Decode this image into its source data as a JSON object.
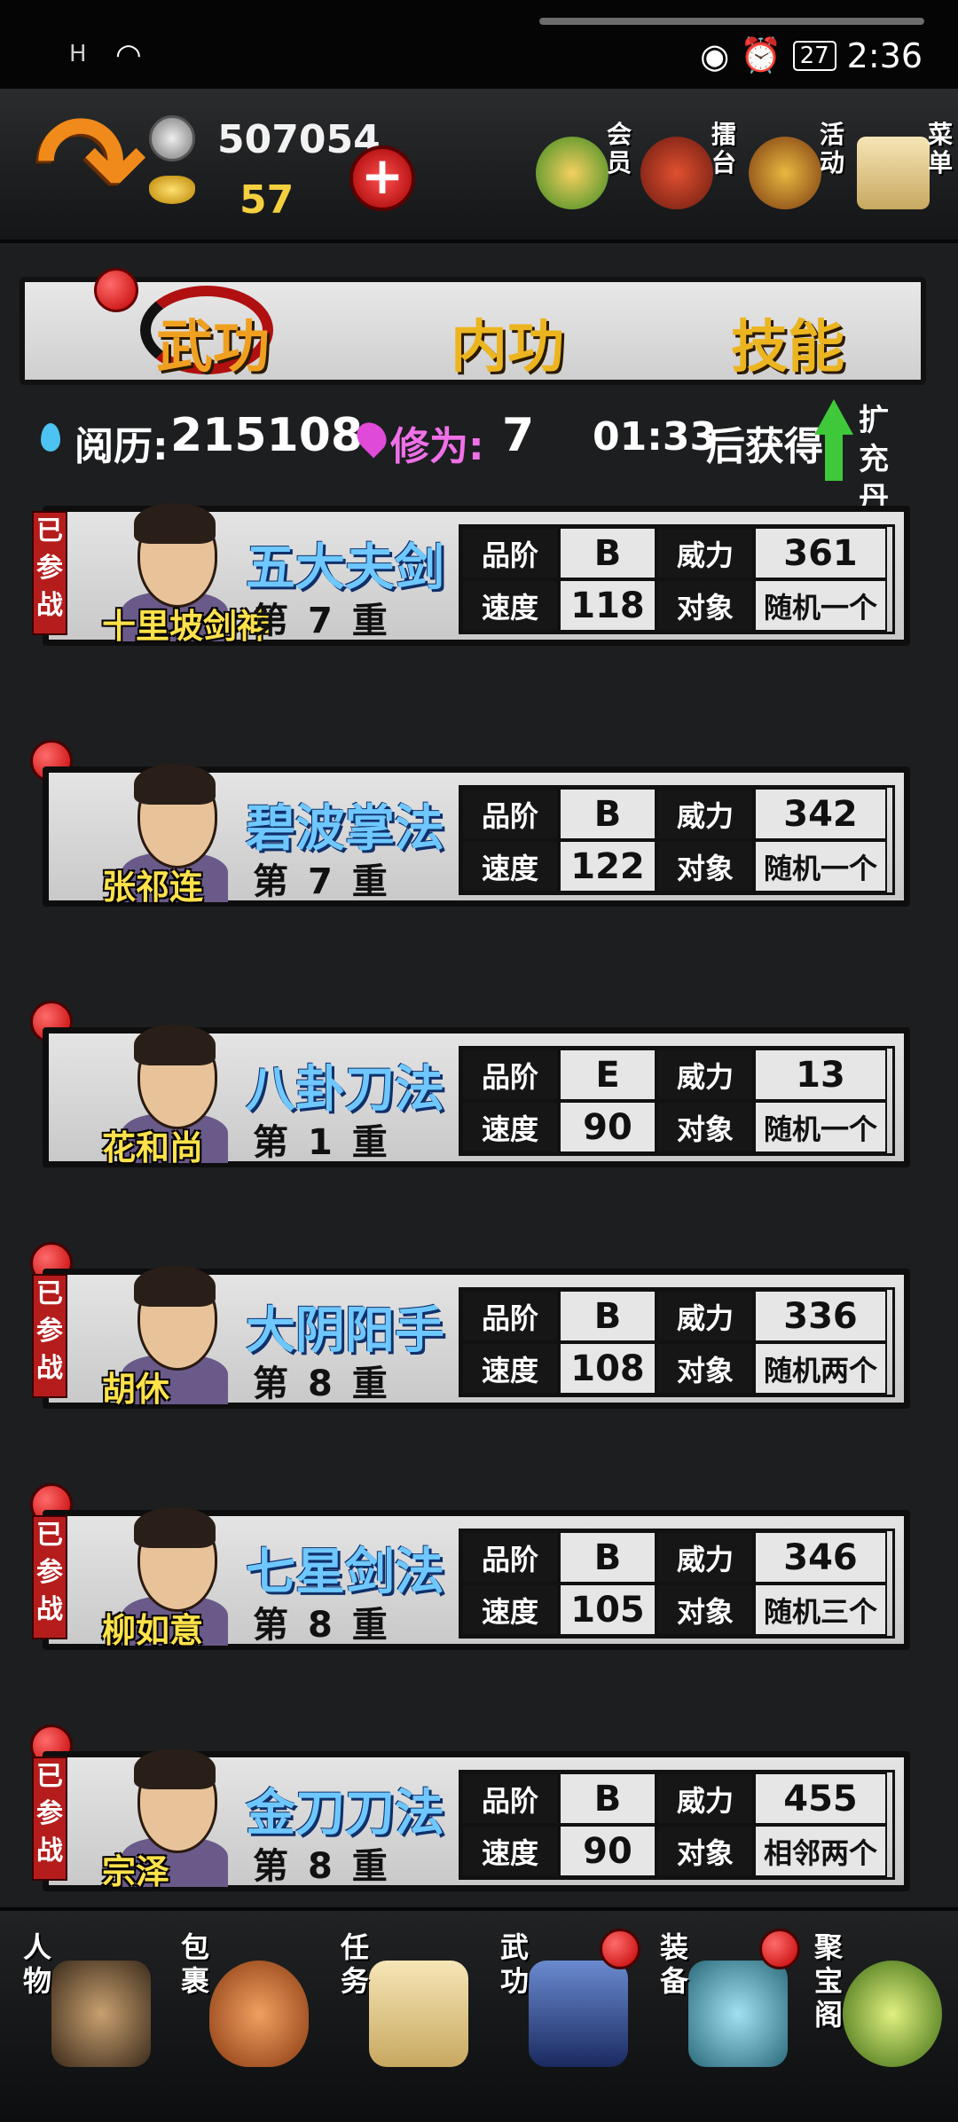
{
  "status_bar": {
    "signal": "H",
    "battery": "27",
    "time": "2:36"
  },
  "currency": {
    "silver": "507054",
    "gold": "57"
  },
  "top_menu": [
    {
      "id": "member",
      "label": "会员"
    },
    {
      "id": "arena",
      "label": "擂台"
    },
    {
      "id": "activity",
      "label": "活动"
    },
    {
      "id": "menu",
      "label": "菜单"
    }
  ],
  "tabs": [
    {
      "id": "martial",
      "label": "武功",
      "active": true
    },
    {
      "id": "inner",
      "label": "内功",
      "active": false
    },
    {
      "id": "skill",
      "label": "技能",
      "active": false
    }
  ],
  "stats": {
    "experience_label": "阅历:",
    "experience_value": "215108",
    "cultivation_label": "修为:",
    "cultivation_value": "7",
    "timer": "01:33",
    "timer_suffix": "后获得",
    "expand_label": "扩充丹田"
  },
  "labels": {
    "grade": "品阶",
    "power": "威力",
    "speed": "速度",
    "target": "对象",
    "level_prefix": "第",
    "level_suffix": "重",
    "in_battle": "已参战"
  },
  "cards": [
    {
      "character": "十里坡剑神",
      "skill": "五大夫剑",
      "level": "7",
      "grade": "B",
      "power": "361",
      "speed": "118",
      "target": "随机一个",
      "in_battle": true,
      "dot": false
    },
    {
      "character": "张祁连",
      "skill": "碧波掌法",
      "level": "7",
      "grade": "B",
      "power": "342",
      "speed": "122",
      "target": "随机一个",
      "in_battle": false,
      "dot": true
    },
    {
      "character": "花和尚",
      "skill": "八卦刀法",
      "level": "1",
      "grade": "E",
      "power": "13",
      "speed": "90",
      "target": "随机一个",
      "in_battle": false,
      "dot": true
    },
    {
      "character": "胡休",
      "skill": "大阴阳手",
      "level": "8",
      "grade": "B",
      "power": "336",
      "speed": "108",
      "target": "随机两个",
      "in_battle": true,
      "dot": true
    },
    {
      "character": "柳如意",
      "skill": "七星剑法",
      "level": "8",
      "grade": "B",
      "power": "346",
      "speed": "105",
      "target": "随机三个",
      "in_battle": true,
      "dot": true
    },
    {
      "character": "宗泽",
      "skill": "金刀刀法",
      "level": "8",
      "grade": "B",
      "power": "455",
      "speed": "90",
      "target": "相邻两个",
      "in_battle": true,
      "dot": true
    }
  ],
  "bottom_nav": [
    {
      "id": "character",
      "label": "人物",
      "dot": false
    },
    {
      "id": "bag",
      "label": "包裹",
      "dot": false
    },
    {
      "id": "quest",
      "label": "任务",
      "dot": false
    },
    {
      "id": "martial",
      "label": "武功",
      "dot": true
    },
    {
      "id": "equip",
      "label": "装备",
      "dot": true
    },
    {
      "id": "treasure",
      "label": "聚宝阁",
      "dot": false
    }
  ],
  "colors": {
    "accent_red": "#c00000",
    "skill_blue": "#6ec8ff",
    "name_yellow": "#ffe24a",
    "tab_gold": "#ecb520"
  }
}
